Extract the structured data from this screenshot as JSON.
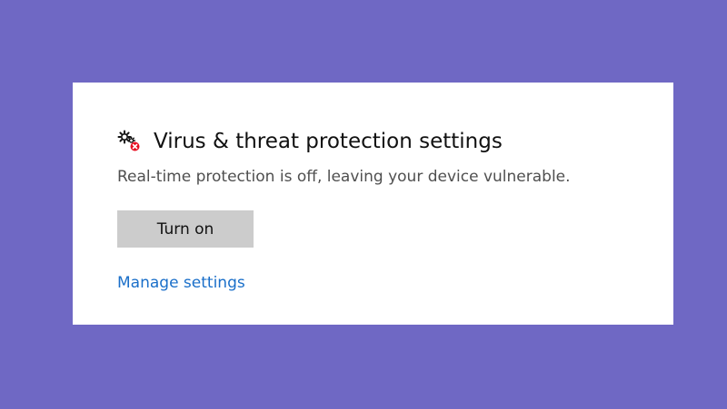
{
  "panel": {
    "title": "Virus & threat protection settings",
    "icon": "settings-gears-warning-icon",
    "description": "Real-time protection is off, leaving your device vulnerable.",
    "turn_on_label": "Turn on",
    "manage_link_label": "Manage settings"
  },
  "colors": {
    "background": "#6f68c4",
    "card": "#ffffff",
    "button": "#cccccc",
    "link": "#1a6fc9",
    "warning_badge": "#e81123"
  }
}
